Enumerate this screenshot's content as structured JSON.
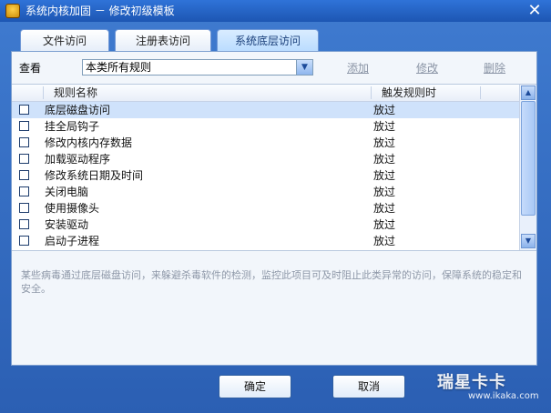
{
  "window": {
    "title": "系统内核加固 － 修改初级模板",
    "close_label": "✕"
  },
  "tabs": [
    {
      "label": "文件访问",
      "active": false
    },
    {
      "label": "注册表访问",
      "active": false
    },
    {
      "label": "系统底层访问",
      "active": true
    }
  ],
  "filter": {
    "label": "查看",
    "selected": "本类所有规则",
    "arrow": "▼"
  },
  "actions": {
    "add": "添加",
    "edit": "修改",
    "delete": "删除"
  },
  "table": {
    "columns": [
      "规则名称",
      "触发规则时"
    ],
    "rows": [
      {
        "name": "底层磁盘访问",
        "action": "放过",
        "checked": false,
        "selected": true
      },
      {
        "name": "挂全局钩子",
        "action": "放过",
        "checked": false,
        "selected": false
      },
      {
        "name": "修改内核内存数据",
        "action": "放过",
        "checked": false,
        "selected": false
      },
      {
        "name": "加载驱动程序",
        "action": "放过",
        "checked": false,
        "selected": false
      },
      {
        "name": "修改系统日期及时间",
        "action": "放过",
        "checked": false,
        "selected": false
      },
      {
        "name": "关闭电脑",
        "action": "放过",
        "checked": false,
        "selected": false
      },
      {
        "name": "使用摄像头",
        "action": "放过",
        "checked": false,
        "selected": false
      },
      {
        "name": "安装驱动",
        "action": "放过",
        "checked": false,
        "selected": false
      },
      {
        "name": "启动子进程",
        "action": "放过",
        "checked": false,
        "selected": false
      }
    ],
    "scroll_up": "▲",
    "scroll_down": "▼"
  },
  "description": "某些病毒通过底层磁盘访问，来躲避杀毒软件的检测，监控此项目可及时阻止此类异常的访问，保障系统的稳定和安全。",
  "buttons": {
    "ok": "确定",
    "cancel": "取消"
  },
  "watermark": {
    "main": "瑞星卡卡",
    "sub": "www.ikaka.com"
  }
}
